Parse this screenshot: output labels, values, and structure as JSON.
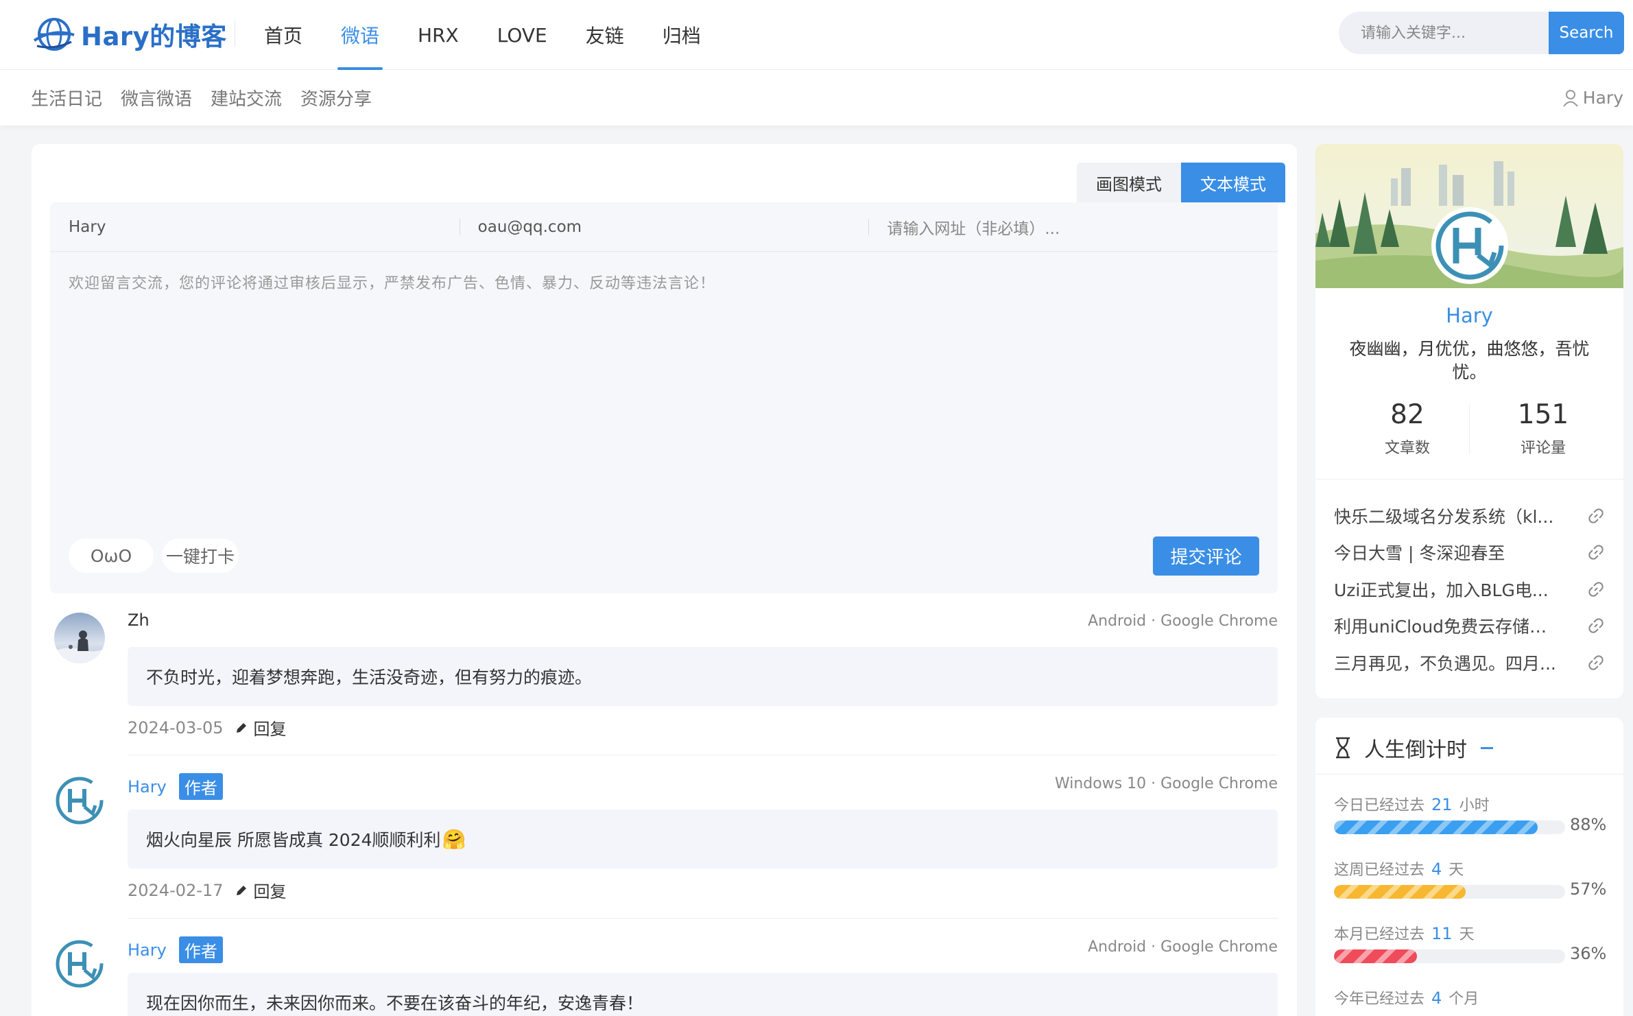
{
  "header": {
    "logo_text": "Hary的博客",
    "nav": [
      {
        "label": "首页",
        "active": false
      },
      {
        "label": "微语",
        "active": true
      },
      {
        "label": "HRX",
        "active": false
      },
      {
        "label": "LOVE",
        "active": false
      },
      {
        "label": "友链",
        "active": false
      },
      {
        "label": "归档",
        "active": false
      }
    ],
    "search_placeholder": "请输入关键字...",
    "search_button": "Search"
  },
  "subnav": {
    "items": [
      "生活日记",
      "微言微语",
      "建站交流",
      "资源分享"
    ],
    "user": "Hary"
  },
  "form": {
    "mode_tabs": [
      "画图模式",
      "文本模式"
    ],
    "active_mode": "文本模式",
    "name_value": "Hary",
    "email_value": "oau@qq.com",
    "url_placeholder": "请输入网址（非必填）...",
    "textarea_placeholder": "欢迎留言交流，您的评论将通过审核后显示，严禁发布广告、色情、暴力、反动等违法言论！",
    "owo_label": "OωO",
    "checkin_label": "一键打卡",
    "submit_label": "提交评论"
  },
  "comments": [
    {
      "name": "Zh",
      "is_author": false,
      "badge": "",
      "ua": "Android · Google Chrome",
      "text": "不负时光，迎着梦想奔跑，生活没奇迹，但有努力的痕迹。",
      "date": "2024-03-05",
      "reply": "回复"
    },
    {
      "name": "Hary",
      "is_author": true,
      "badge": "作者",
      "ua": "Windows 10 · Google Chrome",
      "text": "烟火向星辰 所愿皆成真 2024顺顺利利",
      "emoji": "🤗",
      "date": "2024-02-17",
      "reply": "回复"
    },
    {
      "name": "Hary",
      "is_author": true,
      "badge": "作者",
      "ua": "Android · Google Chrome",
      "text": "现在因你而生，未来因你而来。不要在该奋斗的年纪，安逸青春！",
      "date": "",
      "reply": "回复"
    }
  ],
  "profile": {
    "name": "Hary",
    "motto": "夜幽幽，月优优，曲悠悠，吾忧忧。",
    "articles_count": "82",
    "articles_label": "文章数",
    "comments_count": "151",
    "comments_label": "评论量",
    "links": [
      "快乐二级域名分发系统（kl...",
      "今日大雪 | 冬深迎春至",
      "Uzi正式复出，加入BLG电...",
      "利用uniCloud免费云存储自...",
      "三月再见，不负遇见。四月..."
    ]
  },
  "timer": {
    "title": "人生倒计时",
    "rows": [
      {
        "prefix": "今日已经过去",
        "num": "21",
        "unit": "小时",
        "pct_label": "88%",
        "pct": 88,
        "color": "blue"
      },
      {
        "prefix": "这周已经过去",
        "num": "4",
        "unit": "天",
        "pct_label": "57%",
        "pct": 57,
        "color": "orange"
      },
      {
        "prefix": "本月已经过去",
        "num": "11",
        "unit": "天",
        "pct_label": "36%",
        "pct": 36,
        "color": "red"
      },
      {
        "prefix": "今年已经过去",
        "num": "4",
        "unit": "个月",
        "pct_label": "",
        "pct": 0,
        "color": "blue"
      }
    ]
  },
  "colors": {
    "accent": "#3a8ee6"
  }
}
